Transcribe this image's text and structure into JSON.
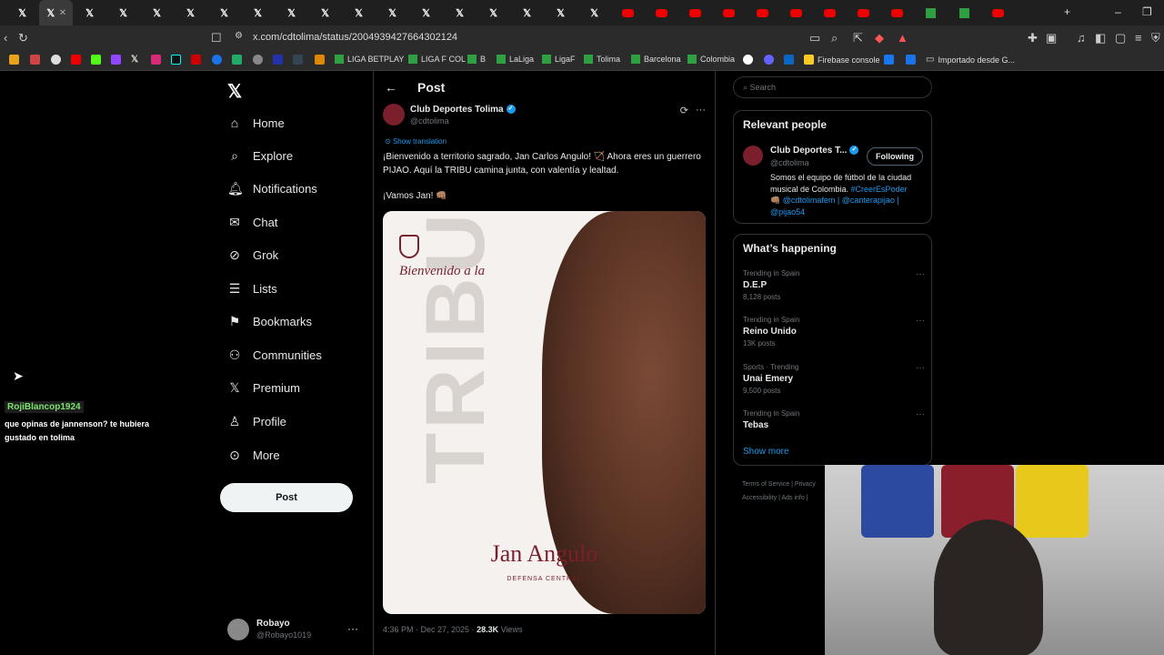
{
  "browser": {
    "url": "x.com/cdtolima/status/2004939427664302124",
    "bookmarks": [
      "LIGA BETPLAY",
      "LIGA F COL",
      "B",
      "LaLiga",
      "LigaF",
      "Tolima",
      "Barcelona",
      "Colombia",
      "Firebase console",
      "Importado desde G..."
    ]
  },
  "nav": {
    "items": [
      "Home",
      "Explore",
      "Notifications",
      "Chat",
      "Grok",
      "Lists",
      "Bookmarks",
      "Communities",
      "Premium",
      "Profile",
      "More"
    ],
    "icons": [
      "home-icon",
      "explore-icon",
      "bell-icon",
      "mail-icon",
      "grok-icon",
      "list-icon",
      "bookmark-icon",
      "communities-icon",
      "x-icon",
      "person-icon",
      "more-icon"
    ],
    "post_button": "Post",
    "user_name": "Robayo",
    "user_handle": "@Robayo1019"
  },
  "chat_overlay": {
    "user": "RojiBlancop1924",
    "line1": "que opinas de jannenson? te hubiera",
    "line2": "gustado en tolima"
  },
  "post": {
    "header_title": "Post",
    "author_name": "Club Deportes Tolima",
    "author_handle": "@cdtolima",
    "translate_label": "Show translation",
    "text1": "¡Bienvenido a territorio sagrado, Jan Carlos Angulo! 🏹 Ahora eres un guerrero PIJAO. Aquí la TRIBU camina junta, con valentía y lealtad.",
    "text2": "¡Vamos Jan! 👊🏽",
    "image": {
      "bg_word": "TRIBU",
      "welcome": "Bienvenido a la",
      "name": "Jan Angulo",
      "position": "DEFENSA CENTRAL"
    },
    "time": "4:36 PM · Dec 27, 2025 · ",
    "views_count": "28.3K",
    "views_label": " Views"
  },
  "sidebar": {
    "search_placeholder": "Search",
    "relevant_title": "Relevant people",
    "rp_name": "Club Deportes T...",
    "rp_handle": "@cdtolima",
    "rp_button": "Following",
    "rp_bio_text": "Somos el equipo de fútbol de la ciudad musical de Colombia. ",
    "rp_bio_hashtag": "#CreerEsPoder",
    "rp_bio_links": "👊🏽 @cdtolimafem | @canterapijao | @pijao54",
    "happening_title": "What’s happening",
    "trends": [
      {
        "context": "Trending in Spain",
        "title": "D.E.P",
        "count": "8,128 posts"
      },
      {
        "context": "Trending in Spain",
        "title": "Reino Unido",
        "count": "13K posts"
      },
      {
        "context": "Sports · Trending",
        "title": "Unai Emery",
        "count": "9,500 posts"
      },
      {
        "context": "Trending in Spain",
        "title": "Tebas",
        "count": ""
      }
    ],
    "show_more": "Show more",
    "footer1": "Terms of Service  |  Privacy",
    "footer2": "Accessibility  |  Ads info  |"
  }
}
